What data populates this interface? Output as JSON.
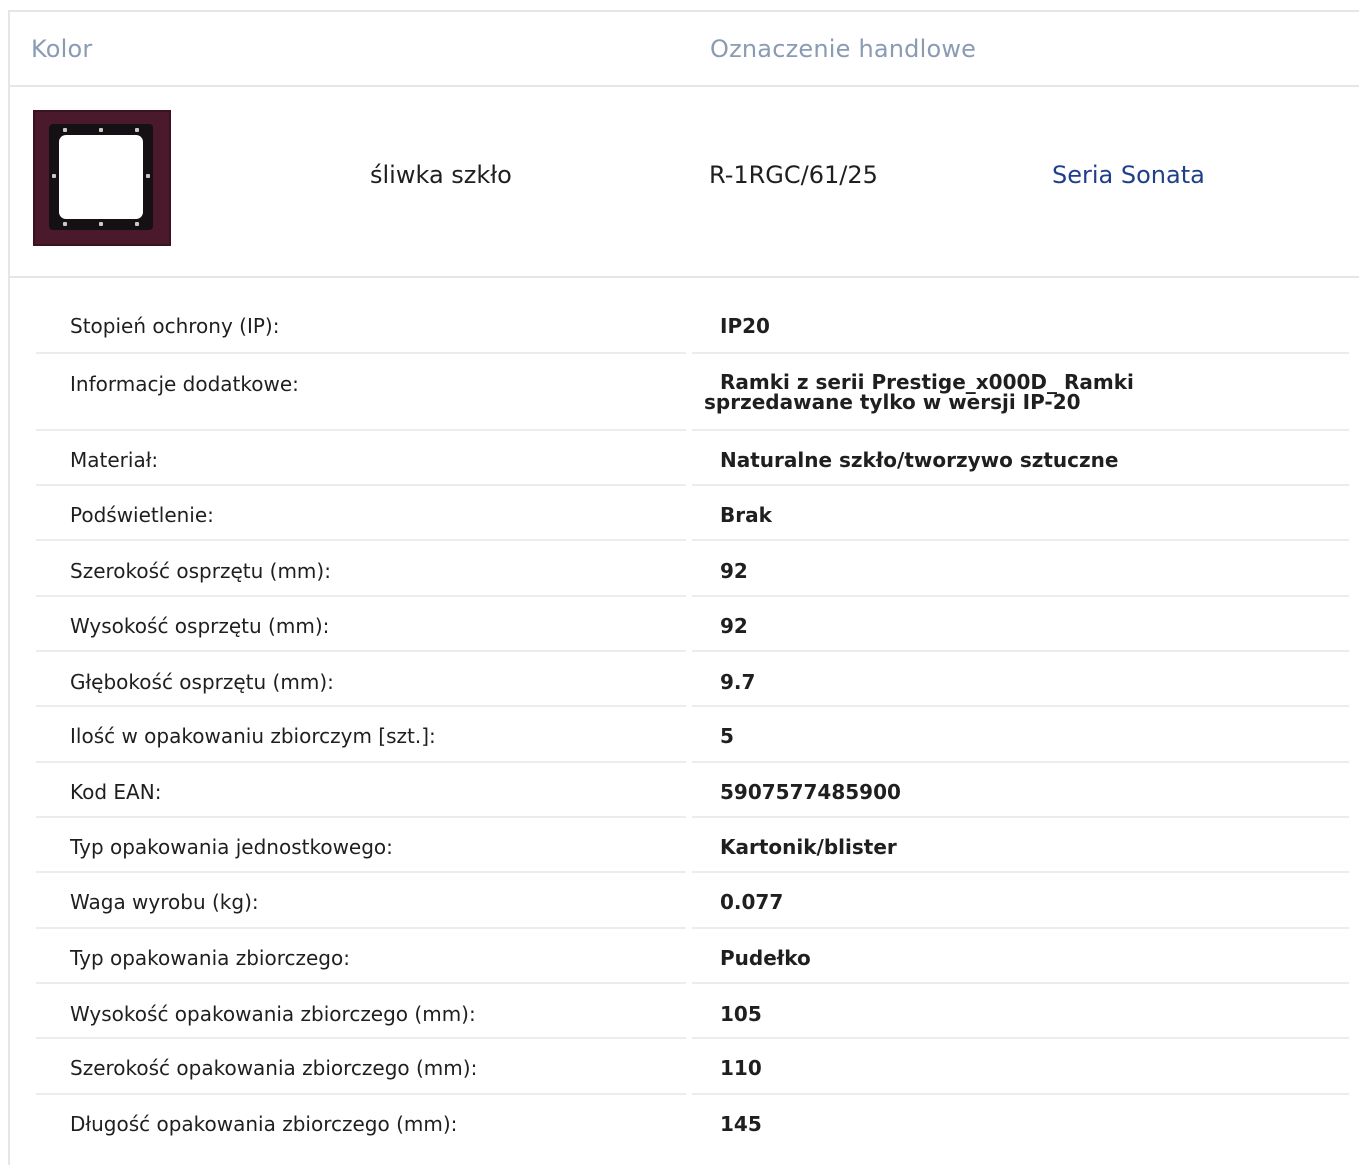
{
  "header": {
    "color_label": "Kolor",
    "trade_label": "Oznaczenie handlowe"
  },
  "product": {
    "color_name": "śliwka szkło",
    "code": "R-1RGC/61/25",
    "series_link": "Seria Sonata",
    "thumbnail_icon": "frame-thumbnail-image",
    "thumb_color": "#4a1a2c"
  },
  "specs": [
    {
      "label": "Stopień ochrony (IP):",
      "value": "IP20"
    },
    {
      "label": "Informacje dodatkowe:",
      "value_line1": "Ramki z serii Prestige_x000D_ Ramki",
      "value_line2": "sprzedawane tylko w wersji IP-20"
    },
    {
      "label": "Materiał:",
      "value": "Naturalne szkło/tworzywo sztuczne"
    },
    {
      "label": "Podświetlenie:",
      "value": "Brak"
    },
    {
      "label": "Szerokość osprzętu (mm):",
      "value": "92"
    },
    {
      "label": "Wysokość osprzętu (mm):",
      "value": "92"
    },
    {
      "label": "Głębokość osprzętu (mm):",
      "value": "9.7"
    },
    {
      "label": "Ilość w opakowaniu zbiorczym [szt.]:",
      "value": "5"
    },
    {
      "label": "Kod EAN:",
      "value": "5907577485900"
    },
    {
      "label": "Typ opakowania jednostkowego:",
      "value": "Kartonik/blister"
    },
    {
      "label": "Waga wyrobu (kg):",
      "value": "0.077"
    },
    {
      "label": "Typ opakowania zbiorczego:",
      "value": "Pudełko"
    },
    {
      "label": "Wysokość opakowania zbiorczego (mm):",
      "value": "105"
    },
    {
      "label": "Szerokość opakowania zbiorczego (mm):",
      "value": "110"
    },
    {
      "label": "Długość opakowania zbiorczego (mm):",
      "value": "145"
    }
  ]
}
